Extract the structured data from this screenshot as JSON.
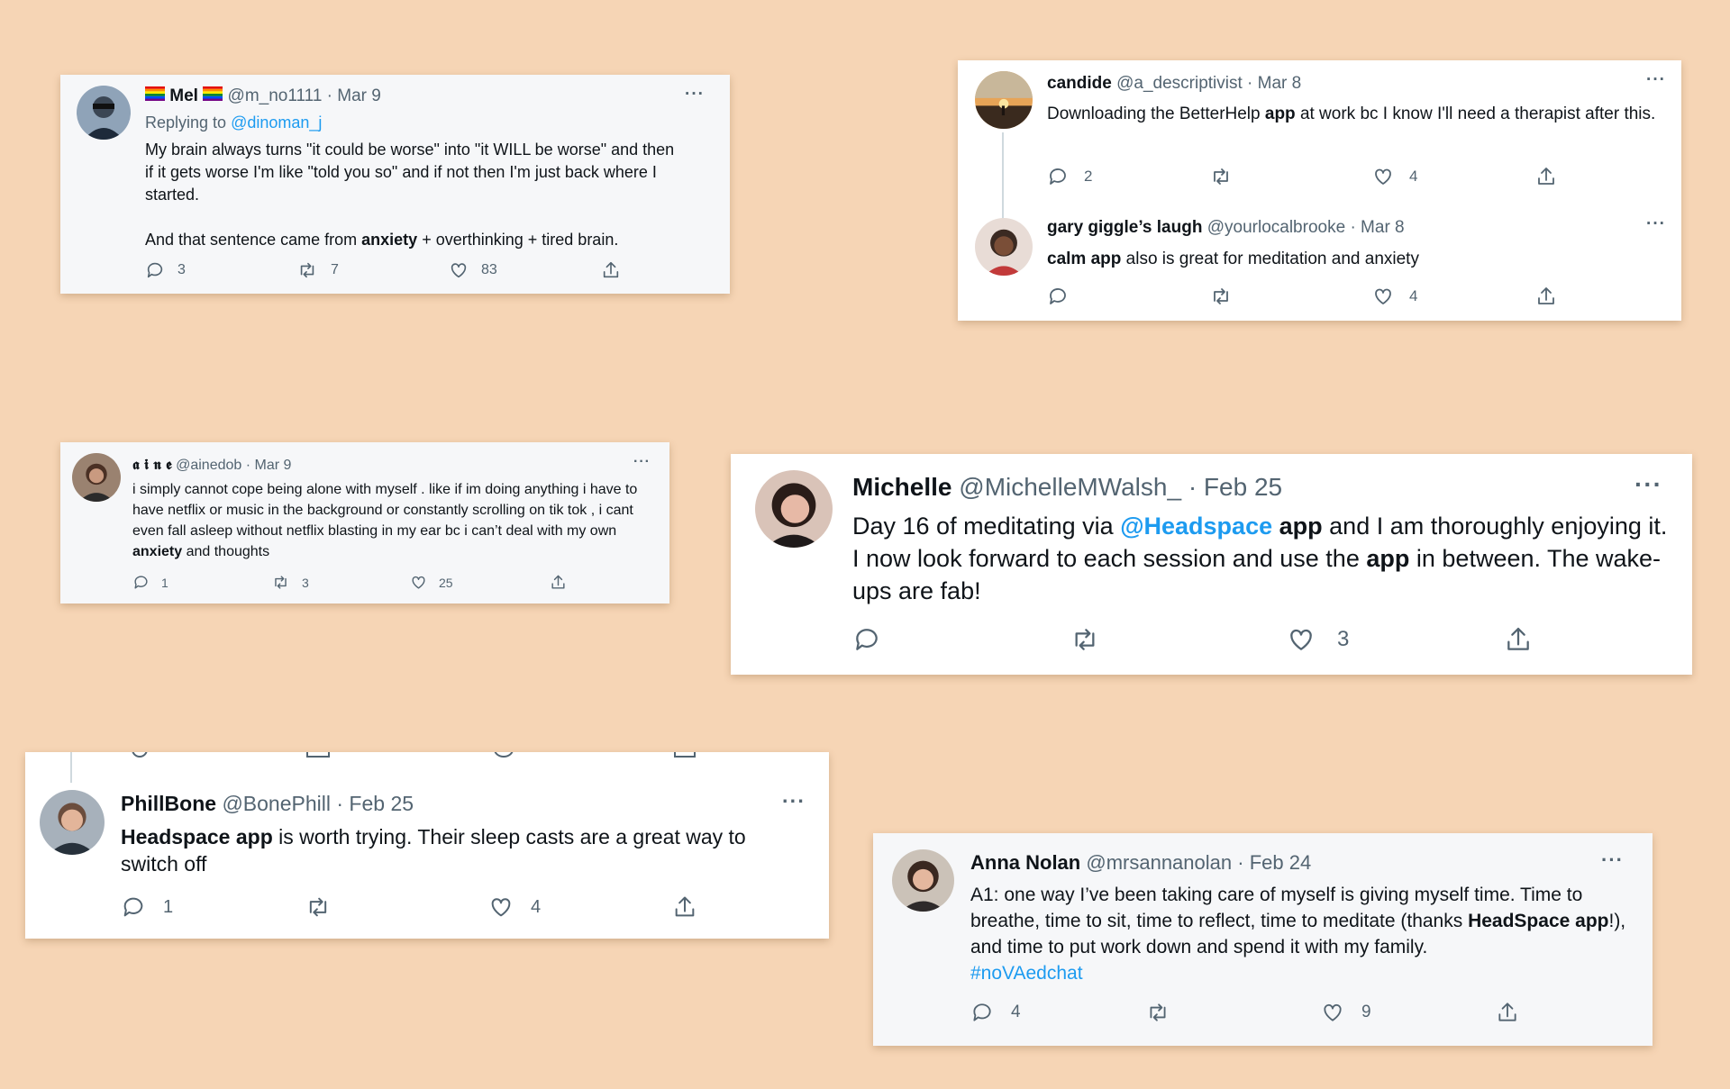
{
  "tweets": {
    "mel": {
      "name": "Mel",
      "handle": "@m_no1111",
      "date": "· Mar 9",
      "replying_label": "Replying to",
      "replying_handle": "@dinoman_j",
      "p1": "My brain always turns \"it could be worse\" into \"it WILL be worse\" and then if it gets worse I'm like \"told you so\" and if not then I'm just back where I started.",
      "p2_a": "And that sentence came from",
      "p2_b": "anxiety",
      "p2_c": "+ overthinking + tired brain.",
      "replies": "3",
      "retweets": "7",
      "likes": "83"
    },
    "candide": {
      "name": "candide",
      "handle": "@a_descriptivist",
      "date": "· Mar 8",
      "text_a": "Downloading the BetterHelp",
      "text_b": "app",
      "text_c": "at work bc I know I'll need a therapist after this.",
      "replies": "2",
      "likes": "4"
    },
    "gary": {
      "name": "gary giggle’s laugh",
      "handle": "@yourlocalbrooke",
      "date": "· Mar 8",
      "text_a": "calm app",
      "text_b": "also is great for meditation and anxiety",
      "likes": "4"
    },
    "aine": {
      "name": "𝖆 𝖎 𝖓 𝖊",
      "handle": "@ainedob",
      "date": "· Mar 9",
      "text_a": "i simply cannot cope being alone with myself . like if im doing anything i have to have netflix or music in the background or constantly scrolling on tik tok , i cant even fall asleep without netflix blasting in my ear bc i can’t deal with my own",
      "text_b": "anxiety",
      "text_c": "and thoughts",
      "replies": "1",
      "retweets": "3",
      "likes": "25"
    },
    "michelle": {
      "name": "Michelle",
      "handle": "@MichelleMWalsh_",
      "date": "· Feb 25",
      "t1": "Day 16 of meditating via",
      "t2": "@Headspace",
      "t3": "app",
      "t4": "and I am thoroughly enjoying it. I now look forward to each session and use the",
      "t5": "app",
      "t6": "in between. The wake-ups are fab!",
      "likes": "3"
    },
    "phill": {
      "name": "PhillBone",
      "handle": "@BonePhill",
      "date": "· Feb 25",
      "text_a": "Headspace app",
      "text_b": "is worth trying. Their sleep casts are a great way to switch off",
      "replies": "1",
      "likes": "4"
    },
    "anna": {
      "name": "Anna Nolan",
      "handle": "@mrsannanolan",
      "date": "· Feb 24",
      "t1": "A1: one way I’ve been taking care of myself is giving myself time. Time to breathe, time to sit, time to reflect, time to meditate (thanks",
      "t2": "HeadSpace app",
      "t3": "!), and time to put work down and spend it with my family.",
      "hashtag": "#noVAedchat",
      "replies": "4",
      "likes": "9"
    }
  },
  "icons": {
    "reply": "reply-icon",
    "retweet": "retweet-icon",
    "like": "heart-icon",
    "share": "share-icon",
    "more": "more-icon",
    "flag": "rainbow-flag-icon"
  },
  "colors": {
    "background": "#f6d5b5",
    "link": "#1d9bf0",
    "muted": "#536471"
  }
}
